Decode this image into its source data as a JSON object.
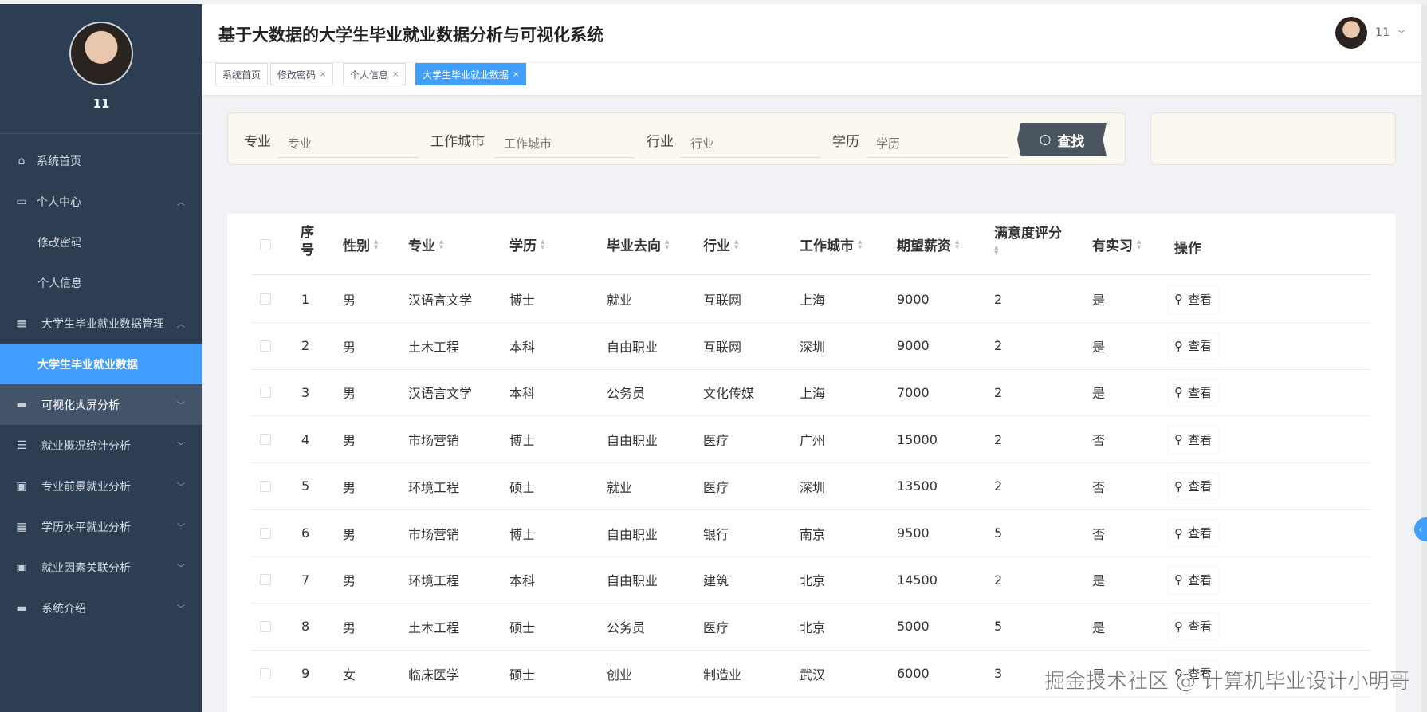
{
  "sidebar": {
    "username": "11",
    "items": [
      {
        "label": "系统首页",
        "icon": "home-icon"
      },
      {
        "label": "个人中心",
        "icon": "wallet-icon"
      },
      {
        "label": "修改密码"
      },
      {
        "label": "个人信息"
      },
      {
        "label": "大学生毕业就业数据管理",
        "icon": "grid-icon"
      },
      {
        "label": "大学生毕业就业数据"
      },
      {
        "label": "可视化大屏分析",
        "icon": "monitor-icon"
      },
      {
        "label": "就业概况统计分析",
        "icon": "list-icon"
      },
      {
        "label": "专业前景就业分析",
        "icon": "clipboard-icon"
      },
      {
        "label": "学历水平就业分析",
        "icon": "grid-icon"
      },
      {
        "label": "就业因素关联分析",
        "icon": "clipboard-icon"
      },
      {
        "label": "系统介绍",
        "icon": "card-icon"
      }
    ]
  },
  "header": {
    "title": "基于大数据的大学生毕业就业数据分析与可视化系统",
    "user": "11"
  },
  "tabs": [
    {
      "label": "系统首页"
    },
    {
      "label": "修改密码"
    },
    {
      "label": "个人信息"
    },
    {
      "label": "大学生毕业就业数据"
    }
  ],
  "search": {
    "major_label": "专业",
    "major_placeholder": "专业",
    "city_label": "工作城市",
    "city_placeholder": "工作城市",
    "industry_label": "行业",
    "industry_placeholder": "行业",
    "edu_label": "学历",
    "edu_placeholder": "学历",
    "button": "查找"
  },
  "table": {
    "headers": {
      "index_a": "序",
      "index_b": "号",
      "gender": "性别",
      "major": "专业",
      "edu": "学历",
      "destination": "毕业去向",
      "industry": "行业",
      "city": "工作城市",
      "salary": "期望薪资",
      "satisfaction": "满意度评分",
      "internship": "有实习",
      "action": "操作"
    },
    "view_label": "查看",
    "rows": [
      {
        "idx": "1",
        "gender": "男",
        "major": "汉语言文学",
        "edu": "博士",
        "dest": "就业",
        "industry": "互联网",
        "city": "上海",
        "salary": "9000",
        "score": "2",
        "intern": "是"
      },
      {
        "idx": "2",
        "gender": "男",
        "major": "土木工程",
        "edu": "本科",
        "dest": "自由职业",
        "industry": "互联网",
        "city": "深圳",
        "salary": "9000",
        "score": "2",
        "intern": "是"
      },
      {
        "idx": "3",
        "gender": "男",
        "major": "汉语言文学",
        "edu": "本科",
        "dest": "公务员",
        "industry": "文化传媒",
        "city": "上海",
        "salary": "7000",
        "score": "2",
        "intern": "是"
      },
      {
        "idx": "4",
        "gender": "男",
        "major": "市场营销",
        "edu": "博士",
        "dest": "自由职业",
        "industry": "医疗",
        "city": "广州",
        "salary": "15000",
        "score": "2",
        "intern": "否"
      },
      {
        "idx": "5",
        "gender": "男",
        "major": "环境工程",
        "edu": "硕士",
        "dest": "就业",
        "industry": "医疗",
        "city": "深圳",
        "salary": "13500",
        "score": "2",
        "intern": "否"
      },
      {
        "idx": "6",
        "gender": "男",
        "major": "市场营销",
        "edu": "博士",
        "dest": "自由职业",
        "industry": "银行",
        "city": "南京",
        "salary": "9500",
        "score": "5",
        "intern": "否"
      },
      {
        "idx": "7",
        "gender": "男",
        "major": "环境工程",
        "edu": "本科",
        "dest": "自由职业",
        "industry": "建筑",
        "city": "北京",
        "salary": "14500",
        "score": "2",
        "intern": "是"
      },
      {
        "idx": "8",
        "gender": "男",
        "major": "土木工程",
        "edu": "硕士",
        "dest": "公务员",
        "industry": "医疗",
        "city": "北京",
        "salary": "5000",
        "score": "5",
        "intern": "是"
      },
      {
        "idx": "9",
        "gender": "女",
        "major": "临床医学",
        "edu": "硕士",
        "dest": "创业",
        "industry": "制造业",
        "city": "武汉",
        "salary": "6000",
        "score": "3",
        "intern": "是"
      }
    ]
  },
  "watermark": "掘金技术社区 @ 计算机毕业设计小明哥",
  "colors": {
    "sidebar": "#2e3e52",
    "accent": "#409eff",
    "search_bg": "#fbf9ef"
  }
}
